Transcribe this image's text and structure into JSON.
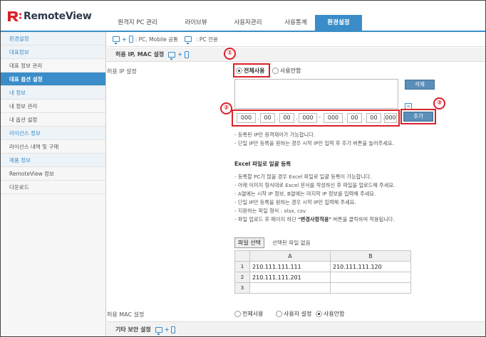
{
  "app": {
    "brand": "RemoteView",
    "accent": "#3a8dc8",
    "brand_red": "#d9222a"
  },
  "tabs": [
    {
      "label": "원격지 PC 관리"
    },
    {
      "label": "라이브뷰"
    },
    {
      "label": "사용자관리"
    },
    {
      "label": "사용통계"
    },
    {
      "label": "환경설정",
      "active": true
    }
  ],
  "sidebar": {
    "items": [
      {
        "label": "환경설정",
        "type": "head"
      },
      {
        "label": "대표정보",
        "type": "head"
      },
      {
        "label": "대표 정보 관리"
      },
      {
        "label": "대표 옵션 설정",
        "active": true
      },
      {
        "label": "내 정보",
        "type": "head"
      },
      {
        "label": "내 정보 관리"
      },
      {
        "label": "내 옵션 설정"
      },
      {
        "label": "라이선스 정보",
        "type": "head"
      },
      {
        "label": "라이선스 내역 및 구매"
      },
      {
        "label": "제품 정보",
        "type": "head"
      },
      {
        "label": "RemoteView 정보"
      },
      {
        "label": "다운로드"
      }
    ]
  },
  "legend": {
    "common": ": PC, Mobile 공통",
    "pc_only": ": PC 전용"
  },
  "section": {
    "title": "허용 IP, MAC 설정"
  },
  "ip": {
    "label": "허용 IP 설정",
    "opt_all": "전체사용",
    "opt_none": "사용안함",
    "delete_btn": "삭제",
    "add_btn": "추가",
    "start": [
      "000",
      "00",
      "00",
      "000"
    ],
    "end": [
      "000",
      "00",
      "00",
      "000"
    ],
    "range_sep": "-",
    "list_icon": "list-icon"
  },
  "notes1": [
    "- 등록된 IP만 원격제어가 가능합니다.",
    "- 단일 IP만 등록을 원하는 경우 시작 IP만 입력 후 추가 버튼을 눌러주세요."
  ],
  "excel": {
    "title": "Excel 파일로 일괄 등록",
    "notes": [
      "- 등록할 PC가 많을 경우 Excel 파일로 일괄 등록이 가능합니다.",
      "- 아래 이미지 형식대로 Excel 문서를 작성하신 후 파일을 업로드해 주세요.",
      "- A열에는 시작 IP 정보, B열에는 마지막 IP 정보를 입력해 주세요.",
      "- 단일 IP만 등록을 원하는 경우 시작 IP만 입력해 주세요.",
      "- 지원하는 파일 형식 : xlsx, csv"
    ],
    "last_note_pre": "- 파일 업로드 후 페이지 하단 ",
    "last_note_bold": "\"변경사항적용\"",
    "last_note_post": " 버튼을 클릭하여 적용됩니다.",
    "file_btn": "파일 선택",
    "file_status": "선택된 파일 없음",
    "sheet": {
      "cols": [
        "A",
        "B"
      ],
      "rows": [
        {
          "n": "1",
          "a": "210.111.111.111",
          "b": "210.111.111.120"
        },
        {
          "n": "2",
          "a": "210.111.111.201",
          "b": ""
        },
        {
          "n": "3",
          "a": "",
          "b": ""
        }
      ]
    }
  },
  "mac": {
    "label": "허용 MAC 설정",
    "opt_all": "전체사용",
    "opt_user": "사용자 설정",
    "opt_none": "사용안함"
  },
  "section2": {
    "title": "기타 보안 설정"
  },
  "callouts": [
    "①",
    "②",
    "③"
  ]
}
